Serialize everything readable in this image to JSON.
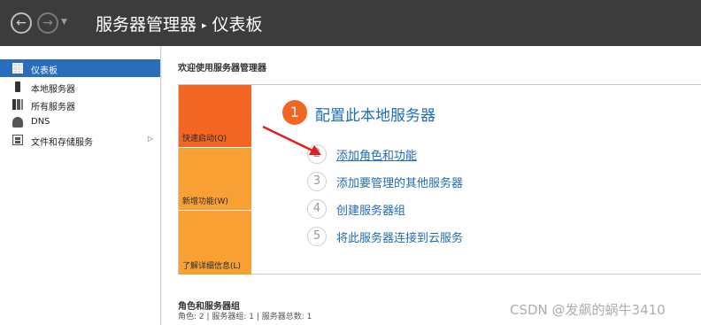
{
  "titlebar": {
    "app": "服务器管理器",
    "separator": "▸",
    "page": "仪表板",
    "back_glyph": "←",
    "forward_glyph": "→",
    "dropdown_glyph": "▼"
  },
  "sidebar": {
    "items": [
      {
        "label": "仪表板",
        "icon": "dashboard-grid-icon"
      },
      {
        "label": "本地服务器",
        "icon": "server-icon"
      },
      {
        "label": "所有服务器",
        "icon": "servers-icon"
      },
      {
        "label": "DNS",
        "icon": "dns-icon"
      },
      {
        "label": "文件和存储服务",
        "icon": "storage-icon",
        "chevron": "▷"
      }
    ]
  },
  "main": {
    "welcome": "欢迎使用服务器管理器",
    "tiles": {
      "quick_start": "快速启动(Q)",
      "new_features": "新增功能(W)",
      "learn_more": "了解详细信息(L)"
    },
    "configure": {
      "number": "1",
      "title": "配置此本地服务器"
    },
    "steps": [
      {
        "num": "2",
        "text": "添加角色和功能"
      },
      {
        "num": "3",
        "text": "添加要管理的其他服务器"
      },
      {
        "num": "4",
        "text": "创建服务器组"
      },
      {
        "num": "5",
        "text": "将此服务器连接到云服务"
      }
    ],
    "roles": {
      "title": "角色和服务器组",
      "summary": "角色: 2 | 服务器组: 1 | 服务器总数: 1"
    }
  },
  "watermark": "CSDN @发飙的蜗牛3410",
  "colors": {
    "titlebar": "#3c3c3c",
    "accent_orange": "#f26522",
    "tile_orange": "#f8a034",
    "link_blue": "#1f6cb5",
    "sidebar_active": "#2a6ebb",
    "arrow_red": "#e02020"
  }
}
